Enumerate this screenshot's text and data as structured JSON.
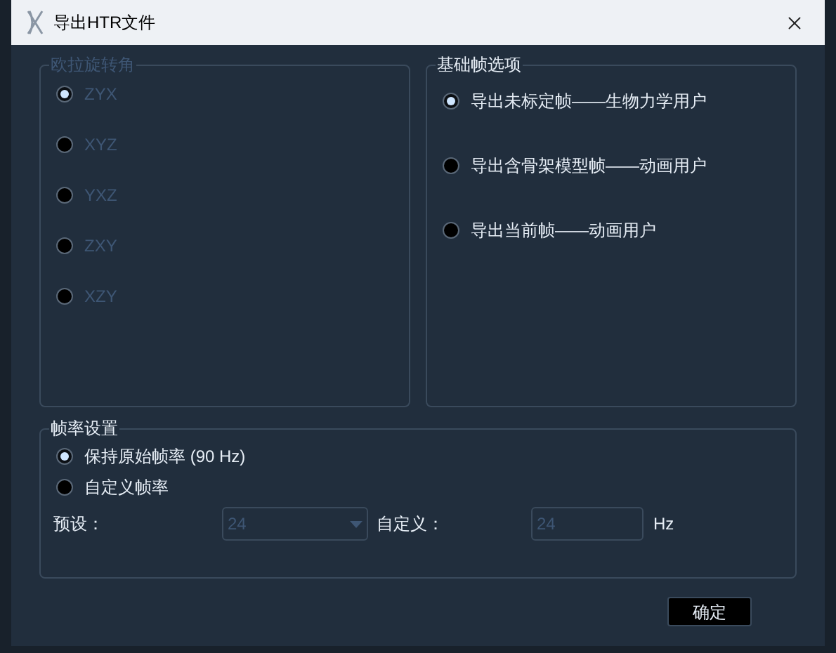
{
  "window": {
    "title": "导出HTR文件"
  },
  "euler_group": {
    "title": "欧拉旋转角",
    "disabled": true,
    "options": [
      {
        "label": "ZYX",
        "selected": true
      },
      {
        "label": "XYZ",
        "selected": false
      },
      {
        "label": "YXZ",
        "selected": false
      },
      {
        "label": "ZXY",
        "selected": false
      },
      {
        "label": "XZY",
        "selected": false
      }
    ]
  },
  "frame_group": {
    "title": "基础帧选项",
    "disabled": false,
    "options": [
      {
        "label": "导出未标定帧——生物力学用户",
        "selected": true
      },
      {
        "label": "导出含骨架模型帧——动画用户",
        "selected": false
      },
      {
        "label": "导出当前帧——动画用户",
        "selected": false
      }
    ]
  },
  "rate_group": {
    "title": "帧率设置",
    "options": [
      {
        "label": "保持原始帧率 (90 Hz)",
        "selected": true
      },
      {
        "label": "自定义帧率",
        "selected": false
      }
    ],
    "preset_label": "预设：",
    "preset_value": "24",
    "custom_label": "自定义：",
    "custom_value": "24",
    "unit": "Hz",
    "inputs_disabled": true
  },
  "ok_button": "确定"
}
